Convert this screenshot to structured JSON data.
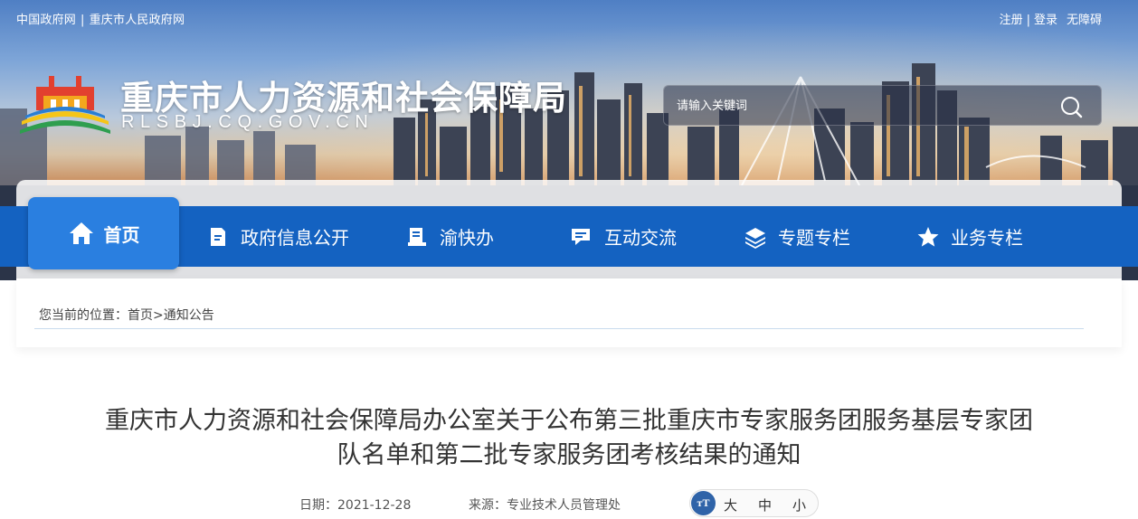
{
  "top_bar": {
    "left_links": [
      "中国政府网",
      "重庆市人民政府网"
    ],
    "separator": "|",
    "register": "注册",
    "login": "登录",
    "accessibility": "无障碍"
  },
  "header": {
    "site_title": "重庆市人力资源和社会保障局",
    "site_url": "RLSBJ.CQ.GOV.CN",
    "search_placeholder": "请输入关键词"
  },
  "nav": {
    "items": [
      {
        "label": "首页",
        "icon": "home-icon",
        "active": true
      },
      {
        "label": "政府信息公开",
        "icon": "document-icon",
        "active": false
      },
      {
        "label": "渝快办",
        "icon": "book-icon",
        "active": false
      },
      {
        "label": "互动交流",
        "icon": "chat-icon",
        "active": false
      },
      {
        "label": "专题专栏",
        "icon": "layers-icon",
        "active": false
      },
      {
        "label": "业务专栏",
        "icon": "star-icon",
        "active": false
      }
    ]
  },
  "breadcrumb": {
    "prefix": "您当前的位置：",
    "home": "首页",
    "arrow": ">",
    "current": "通知公告"
  },
  "article": {
    "title_line1": "重庆市人力资源和社会保障局办公室关于公布第三批重庆市专家服务团服务基层专家团",
    "title_line2": "队名单和第二批专家服务团考核结果的通知",
    "date_label": "日期：",
    "date": "2021-12-28",
    "source_label": "来源：",
    "source": "专业技术人员管理处",
    "font_icon_text": "тT",
    "font_sizes": [
      "大",
      "中",
      "小"
    ]
  },
  "colors": {
    "nav_bg": "#1462c1",
    "nav_active": "#2a7fe0",
    "title_text": "#333333"
  }
}
